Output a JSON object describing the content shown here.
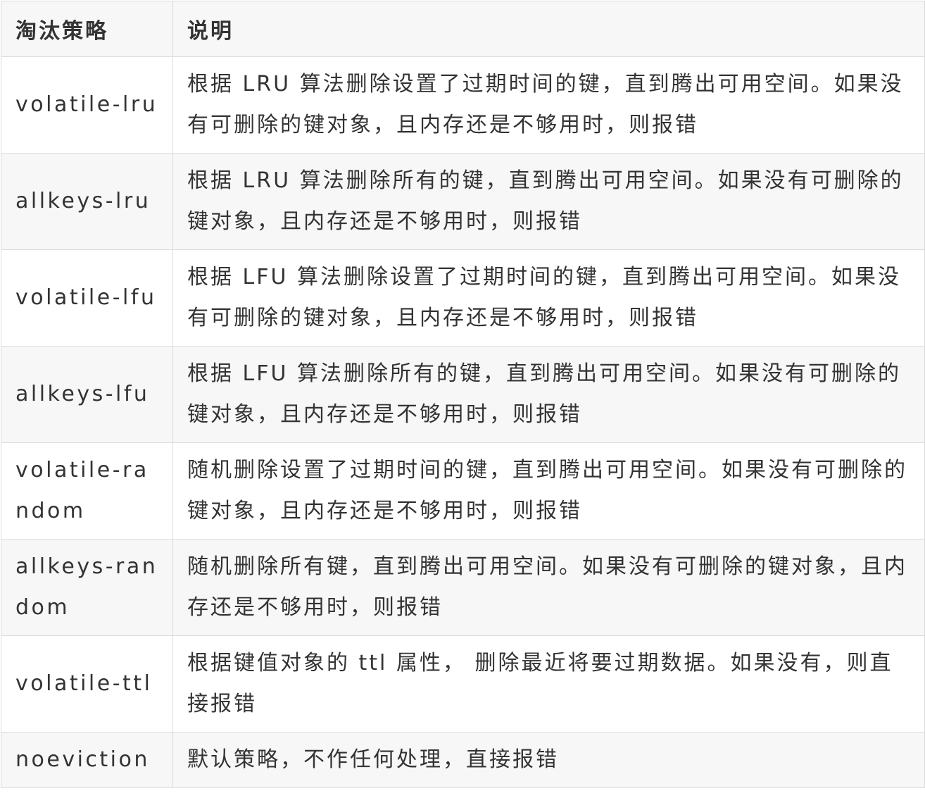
{
  "table": {
    "headers": [
      "淘汰策略",
      "说明"
    ],
    "rows": [
      {
        "name": "volatile-lru",
        "desc": "根据 LRU 算法删除设置了过期时间的键，直到腾出可用空间。如果没有可删除的键对象，且内存还是不够用时，则报错"
      },
      {
        "name": "allkeys-lru",
        "desc": "根据 LRU 算法删除所有的键，直到腾出可用空间。如果没有可删除的键对象，且内存还是不够用时，则报错"
      },
      {
        "name": "volatile-lfu",
        "desc": "根据 LFU 算法删除设置了过期时间的键，直到腾出可用空间。如果没有可删除的键对象，且内存还是不够用时，则报错"
      },
      {
        "name": "allkeys-lfu",
        "desc": "根据 LFU 算法删除所有的键，直到腾出可用空间。如果没有可删除的键对象，且内存还是不够用时，则报错"
      },
      {
        "name": "volatile-random",
        "desc": "随机删除设置了过期时间的键，直到腾出可用空间。如果没有可删除的键对象，且内存还是不够用时，则报错"
      },
      {
        "name": "allkeys-random",
        "desc": "随机删除所有键，直到腾出可用空间。如果没有可删除的键对象，且内存还是不够用时，则报错"
      },
      {
        "name": "volatile-ttl",
        "desc": "根据键值对象的 ttl 属性， 删除最近将要过期数据。如果没有，则直接报错"
      },
      {
        "name": "noeviction",
        "desc": "默认策略，不作任何处理，直接报错"
      }
    ]
  }
}
